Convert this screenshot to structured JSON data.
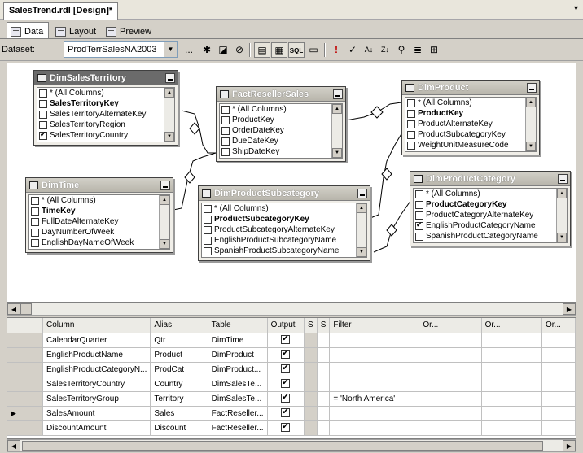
{
  "document": {
    "tab_title": "SalesTrend.rdl [Design]*",
    "pin": "▾"
  },
  "view_tabs": [
    {
      "label": "Data",
      "icon": "data-view-icon",
      "active": true
    },
    {
      "label": "Layout",
      "icon": "layout-view-icon",
      "active": false
    },
    {
      "label": "Preview",
      "icon": "preview-view-icon",
      "active": false
    }
  ],
  "dataset_bar": {
    "label": "Dataset:",
    "selected": "ProdTerrSalesNA2003",
    "more": "...",
    "buttons": [
      {
        "name": "new-dataset-icon",
        "glyph": "✱"
      },
      {
        "name": "edit-dataset-icon",
        "glyph": "◪"
      },
      {
        "name": "delete-dataset-icon",
        "glyph": "⊘"
      },
      {
        "name": "refresh-fields-icon",
        "glyph": "⟳"
      },
      {
        "name": "diagram-pane-icon",
        "glyph": "▤"
      },
      {
        "name": "grid-pane-icon",
        "glyph": "▦"
      },
      {
        "name": "sql-pane-icon",
        "glyph": "SQL"
      },
      {
        "name": "results-pane-icon",
        "glyph": "▭"
      },
      {
        "name": "run-icon",
        "glyph": "!"
      },
      {
        "name": "verify-sql-icon",
        "glyph": "✓"
      },
      {
        "name": "sort-asc-icon",
        "glyph": "A↓"
      },
      {
        "name": "sort-desc-icon",
        "glyph": "Z↓"
      },
      {
        "name": "filter-icon",
        "glyph": "⚲"
      },
      {
        "name": "group-by-icon",
        "glyph": "≣"
      },
      {
        "name": "add-table-icon",
        "glyph": "⊞"
      }
    ]
  },
  "tables": {
    "DimSalesTerritory": {
      "title": "DimSalesTerritory",
      "columns": [
        {
          "label": "* (All Columns)",
          "bold": false,
          "checked": false
        },
        {
          "label": "SalesTerritoryKey",
          "bold": true,
          "checked": false
        },
        {
          "label": "SalesTerritoryAlternateKey",
          "bold": false,
          "checked": false
        },
        {
          "label": "SalesTerritoryRegion",
          "bold": false,
          "checked": false
        },
        {
          "label": "SalesTerritoryCountry",
          "bold": false,
          "checked": true
        }
      ]
    },
    "FactResellerSales": {
      "title": "FactResellerSales",
      "columns": [
        {
          "label": "* (All Columns)",
          "bold": false,
          "checked": false
        },
        {
          "label": "ProductKey",
          "bold": false,
          "checked": false
        },
        {
          "label": "OrderDateKey",
          "bold": false,
          "checked": false
        },
        {
          "label": "DueDateKey",
          "bold": false,
          "checked": false
        },
        {
          "label": "ShipDateKey",
          "bold": false,
          "checked": false
        }
      ]
    },
    "DimProduct": {
      "title": "DimProduct",
      "columns": [
        {
          "label": "* (All Columns)",
          "bold": false,
          "checked": false
        },
        {
          "label": "ProductKey",
          "bold": true,
          "checked": false
        },
        {
          "label": "ProductAlternateKey",
          "bold": false,
          "checked": false
        },
        {
          "label": "ProductSubcategoryKey",
          "bold": false,
          "checked": false
        },
        {
          "label": "WeightUnitMeasureCode",
          "bold": false,
          "checked": false
        }
      ]
    },
    "DimTime": {
      "title": "DimTime",
      "columns": [
        {
          "label": "* (All Columns)",
          "bold": false,
          "checked": false
        },
        {
          "label": "TimeKey",
          "bold": true,
          "checked": false
        },
        {
          "label": "FullDateAlternateKey",
          "bold": false,
          "checked": false
        },
        {
          "label": "DayNumberOfWeek",
          "bold": false,
          "checked": false
        },
        {
          "label": "EnglishDayNameOfWeek",
          "bold": false,
          "checked": false
        }
      ]
    },
    "DimProductSubcategory": {
      "title": "DimProductSubcategory",
      "columns": [
        {
          "label": "* (All Columns)",
          "bold": false,
          "checked": false
        },
        {
          "label": "ProductSubcategoryKey",
          "bold": true,
          "checked": false
        },
        {
          "label": "ProductSubcategoryAlternateKey",
          "bold": false,
          "checked": false
        },
        {
          "label": "EnglishProductSubcategoryName",
          "bold": false,
          "checked": false
        },
        {
          "label": "SpanishProductSubcategoryName",
          "bold": false,
          "checked": false
        }
      ]
    },
    "DimProductCategory": {
      "title": "DimProductCategory",
      "columns": [
        {
          "label": "* (All Columns)",
          "bold": false,
          "checked": false
        },
        {
          "label": "ProductCategoryKey",
          "bold": true,
          "checked": false
        },
        {
          "label": "ProductCategoryAlternateKey",
          "bold": false,
          "checked": false
        },
        {
          "label": "EnglishProductCategoryName",
          "bold": false,
          "checked": true
        },
        {
          "label": "SpanishProductCategoryName",
          "bold": false,
          "checked": false
        }
      ]
    }
  },
  "grid": {
    "headers": [
      "Column",
      "Alias",
      "Table",
      "Output",
      "S",
      "S",
      "Filter",
      "Or...",
      "Or...",
      "Or..."
    ],
    "rows": [
      {
        "column": "CalendarQuarter",
        "alias": "Qtr",
        "table": "DimTime",
        "output": true,
        "filter": "",
        "current": false
      },
      {
        "column": "EnglishProductName",
        "alias": "Product",
        "table": "DimProduct",
        "output": true,
        "filter": "",
        "current": false
      },
      {
        "column": "EnglishProductCategoryN...",
        "alias": "ProdCat",
        "table": "DimProduct...",
        "output": true,
        "filter": "",
        "current": false
      },
      {
        "column": "SalesTerritoryCountry",
        "alias": "Country",
        "table": "DimSalesTe...",
        "output": true,
        "filter": "",
        "current": false
      },
      {
        "column": "SalesTerritoryGroup",
        "alias": "Territory",
        "table": "DimSalesTe...",
        "output": true,
        "filter": "= 'North America'",
        "current": false
      },
      {
        "column": "SalesAmount",
        "alias": "Sales",
        "table": "FactReseller...",
        "output": true,
        "filter": "",
        "current": true
      },
      {
        "column": "DiscountAmount",
        "alias": "Discount",
        "table": "FactReseller...",
        "output": true,
        "filter": "",
        "current": false
      }
    ]
  }
}
